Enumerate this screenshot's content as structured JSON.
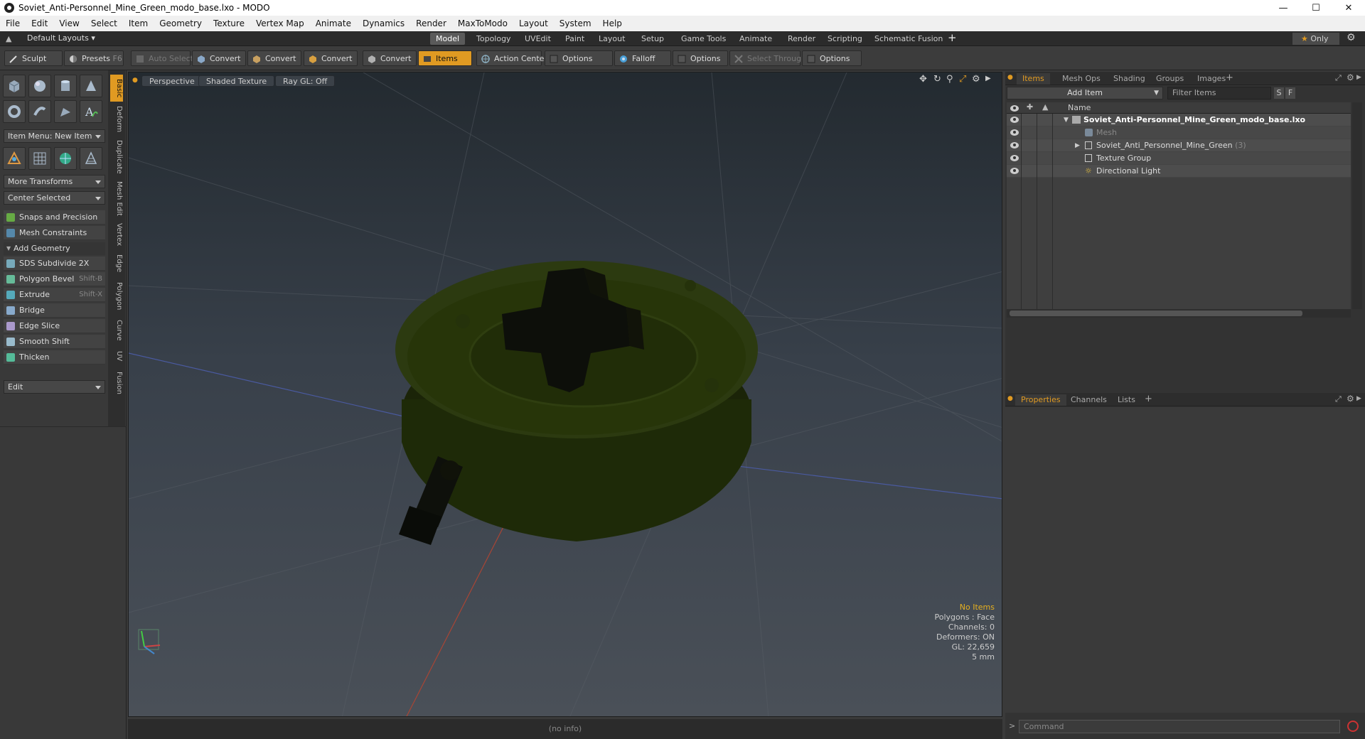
{
  "window": {
    "title": "Soviet_Anti-Personnel_Mine_Green_modo_base.lxo - MODO"
  },
  "menu": [
    "File",
    "Edit",
    "View",
    "Select",
    "Item",
    "Geometry",
    "Texture",
    "Vertex Map",
    "Animate",
    "Dynamics",
    "Render",
    "MaxToModo",
    "Layout",
    "System",
    "Help"
  ],
  "layout_selector": "Default Layouts",
  "layout_tabs": [
    "Model",
    "Topology",
    "UVEdit",
    "Paint",
    "Layout",
    "Setup",
    "Game Tools",
    "Animate",
    "Render",
    "Scripting",
    "Schematic Fusion"
  ],
  "only_label": "Only",
  "toolbar": {
    "sculpt": "Sculpt",
    "presets": "Presets",
    "presets_key": "F6",
    "auto_select": "Auto Select",
    "convert": "Convert",
    "items": "Items",
    "action_center": "Action Center",
    "options": "Options",
    "falloff": "Falloff",
    "select_through": "Select Through"
  },
  "left": {
    "vtabs": [
      "Basic",
      "Deform",
      "Duplicate",
      "Mesh Edit",
      "Vertex",
      "Edge",
      "Polygon",
      "Curve",
      "UV",
      "Fusion"
    ],
    "item_menu": "Item Menu: New Item",
    "more_transforms": "More Transforms",
    "center_selected": "Center Selected",
    "snaps": "Snaps and Precision",
    "mesh_constraints": "Mesh Constraints",
    "add_geometry": "Add Geometry",
    "tools": [
      {
        "label": "SDS Subdivide 2X",
        "shortcut": ""
      },
      {
        "label": "Polygon Bevel",
        "shortcut": "Shift-B"
      },
      {
        "label": "Extrude",
        "shortcut": "Shift-X"
      },
      {
        "label": "Bridge",
        "shortcut": ""
      },
      {
        "label": "Edge Slice",
        "shortcut": ""
      },
      {
        "label": "Smooth Shift",
        "shortcut": ""
      },
      {
        "label": "Thicken",
        "shortcut": ""
      }
    ],
    "edit": "Edit"
  },
  "viewport": {
    "view": "Perspective",
    "shading": "Shaded Texture",
    "raygl": "Ray GL: Off",
    "info": {
      "items": "No Items",
      "polygons": "Polygons : Face",
      "channels": "Channels: 0",
      "deformers": "Deformers: ON",
      "gl": "GL: 22,659",
      "scale": "5 mm"
    },
    "colors": {
      "mine": "#2c3a10",
      "fuse": "#0d0f0a"
    }
  },
  "status": "(no info)",
  "items_panel": {
    "tabs": [
      "Items",
      "Mesh Ops",
      "Shading",
      "Groups",
      "Images"
    ],
    "add_item": "Add Item",
    "filter": "Filter Items",
    "s_btn": "S",
    "f_btn": "F",
    "col_name": "Name",
    "tree": [
      {
        "label": "Soviet_Anti-Personnel_Mine_Green_modo_base.lxo",
        "count": ""
      },
      {
        "label": "Mesh",
        "count": ""
      },
      {
        "label": "Soviet_Anti_Personnel_Mine_Green",
        "count": "(3)"
      },
      {
        "label": "Texture Group",
        "count": ""
      },
      {
        "label": "Directional Light",
        "count": ""
      }
    ]
  },
  "props_panel": {
    "tabs": [
      "Properties",
      "Channels",
      "Lists"
    ]
  },
  "command": {
    "placeholder": "Command"
  }
}
